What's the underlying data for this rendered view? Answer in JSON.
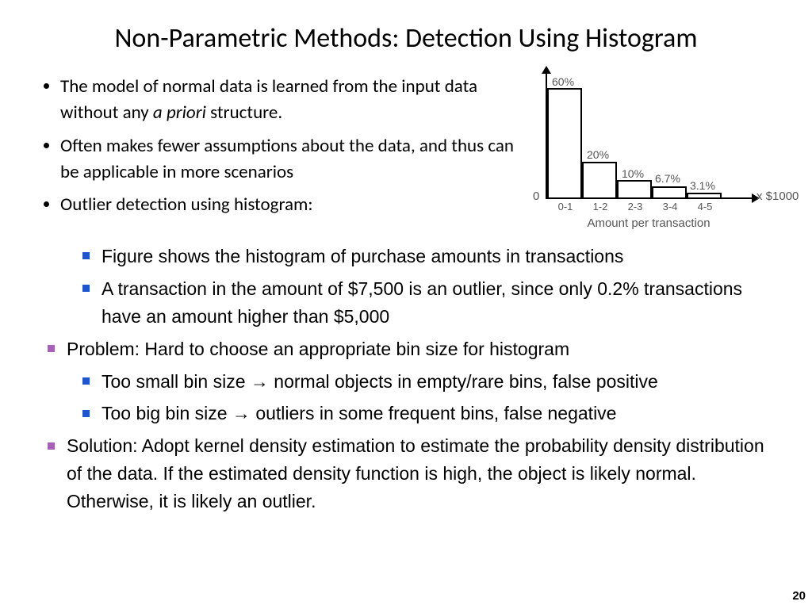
{
  "title": "Non-Parametric Methods: Detection Using Histogram",
  "top_bullets": {
    "b1a": "The model of normal data is learned from the input data without any ",
    "b1i": "a priori",
    "b1b": " structure.",
    "b2": "Often makes fewer assumptions about the data, and thus can be applicable in more scenarios",
    "b3": "Outlier detection using histogram:"
  },
  "body": {
    "s1": "Figure shows the histogram of purchase amounts in transactions",
    "s2": "A transaction in the amount of $7,500 is an outlier, since only 0.2% transactions have an amount higher than $5,000",
    "p1": "Problem: Hard to choose an appropriate bin size for histogram",
    "p1a": "Too small bin size → normal objects in empty/rare bins, false positive",
    "p1b": "Too big bin size → outliers in some frequent bins, false negative",
    "sol": "Solution: Adopt kernel density estimation to estimate the probability density distribution of the data.  If the estimated density function is high, the object is likely normal.  Otherwise, it is likely an outlier."
  },
  "chart_data": {
    "type": "bar",
    "categories": [
      "0-1",
      "1-2",
      "2-3",
      "3-4",
      "4-5"
    ],
    "values": [
      60,
      20,
      10,
      6.7,
      3.1
    ],
    "value_labels": [
      "60%",
      "20%",
      "10%",
      "6.7%",
      "3.1%"
    ],
    "title": "",
    "xlabel": "Amount per transaction",
    "ylabel": "",
    "y_zero_label": "0",
    "x_unit": "x $1000",
    "ylim": [
      0,
      60
    ]
  },
  "page_number": "20"
}
